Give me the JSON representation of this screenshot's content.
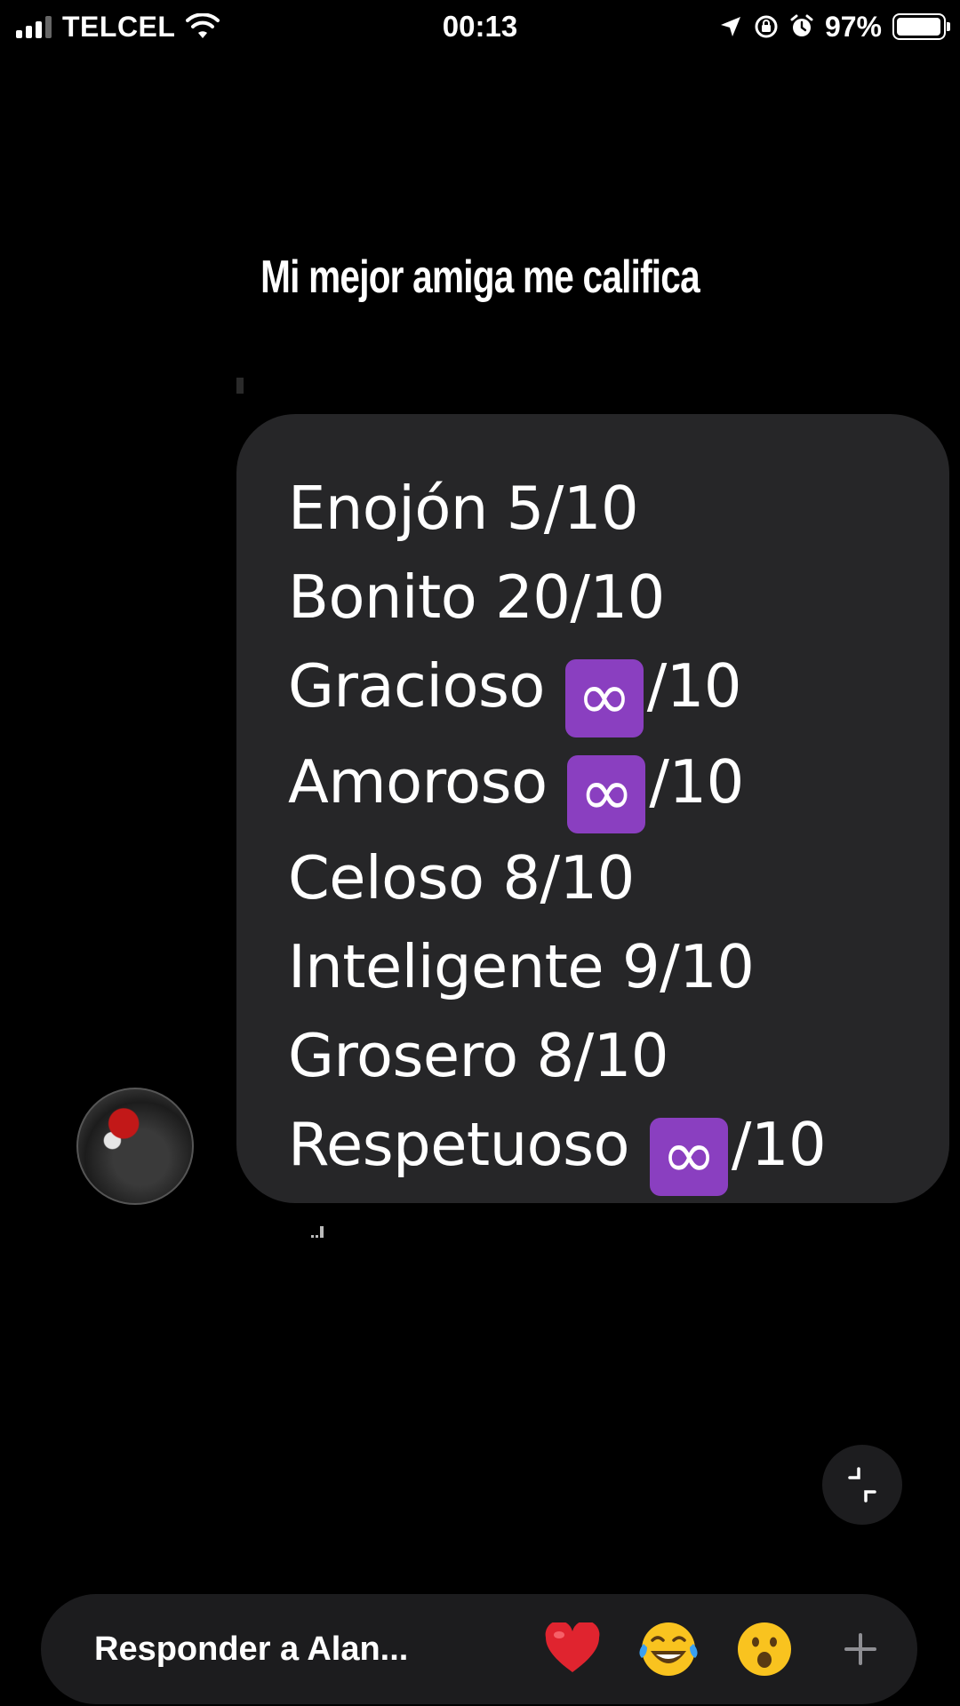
{
  "status_bar": {
    "carrier": "TELCEL",
    "time": "00:13",
    "battery_percent": "97%",
    "battery_level": 0.97,
    "icons": [
      "signal-icon",
      "wifi-icon",
      "location-icon",
      "orientation-lock-icon",
      "alarm-icon",
      "battery-icon"
    ]
  },
  "story": {
    "caption": "Mi mejor amiga me califica"
  },
  "message": {
    "lines": [
      {
        "label": "Enojón",
        "score": "5/10"
      },
      {
        "label": "Bonito",
        "score": "20/10"
      },
      {
        "label": "Gracioso",
        "symbol": "∞",
        "score": "/10"
      },
      {
        "label": "Amoroso",
        "symbol": "∞",
        "score": "/10"
      },
      {
        "label": "Celoso",
        "score": "8/10"
      },
      {
        "label": "Inteligente",
        "score": "9/10"
      },
      {
        "label": "Grosero",
        "score": "8/10"
      },
      {
        "label": "Respetuoso",
        "symbol": "∞",
        "score": "/10"
      }
    ],
    "infinity_color": "#8a3fc0"
  },
  "reply_bar": {
    "placeholder": "Responder a Alan...",
    "reactions": [
      "heart-icon",
      "laughing-crying-icon",
      "surprised-face-icon"
    ],
    "add_icon": "plus-icon"
  }
}
